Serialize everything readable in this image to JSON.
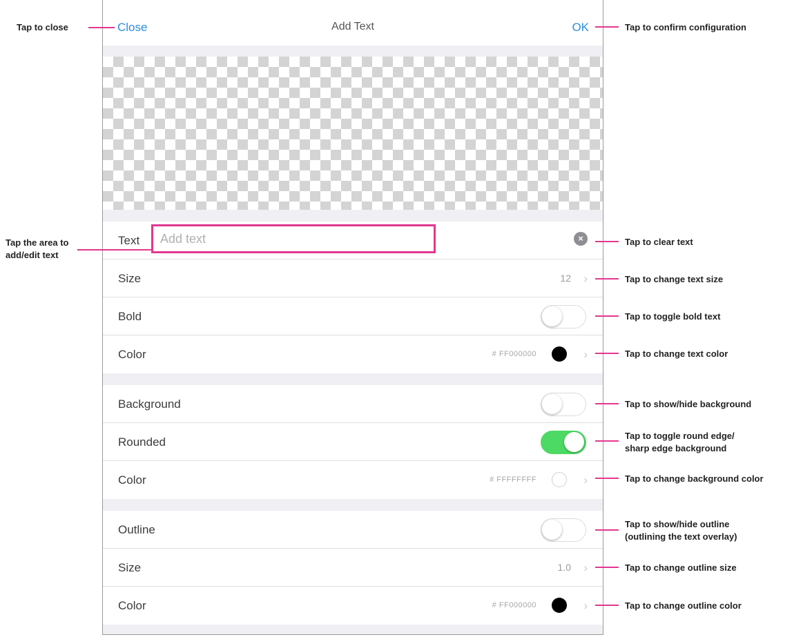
{
  "navbar": {
    "close_label": "Close",
    "title": "Add Text",
    "ok_label": "OK"
  },
  "text_row": {
    "label": "Text",
    "placeholder": "Add text",
    "value": ""
  },
  "size_row": {
    "label": "Size",
    "value": "12"
  },
  "bold_row": {
    "label": "Bold",
    "on": false
  },
  "text_color_row": {
    "label": "Color",
    "hex": "# FF000000",
    "swatch_color": "#000000"
  },
  "background_row": {
    "label": "Background",
    "on": false
  },
  "rounded_row": {
    "label": "Rounded",
    "on": true
  },
  "bg_color_row": {
    "label": "Color",
    "hex": "# FFFFFFFF",
    "swatch_color": "#ffffff"
  },
  "outline_row": {
    "label": "Outline",
    "on": false
  },
  "outline_size_row": {
    "label": "Size",
    "value": "1.0"
  },
  "outline_color_row": {
    "label": "Color",
    "hex": "# FF000000",
    "swatch_color": "#000000"
  },
  "annotations": {
    "close": "Tap to close",
    "ok": "Tap to confirm configuration",
    "text_area": [
      "Tap the area to",
      "add/edit text"
    ],
    "clear": "Tap to clear text",
    "text_size": "Tap to change text size",
    "bold": "Tap to toggle bold text",
    "text_color": "Tap to change text color",
    "background": "Tap to show/hide background",
    "rounded": [
      "Tap to toggle round edge/",
      "sharp edge background"
    ],
    "bg_color": "Tap to change background color",
    "outline": [
      "Tap to show/hide outline",
      "(outlining the text overlay)"
    ],
    "outline_size": "Tap to change outline size",
    "outline_color": "Tap to change outline color"
  },
  "colors": {
    "accent": "#2c8ee0",
    "annotation_pink": "#e2378f",
    "toggle_on": "#4cd964",
    "group_bg": "#efeff4"
  }
}
